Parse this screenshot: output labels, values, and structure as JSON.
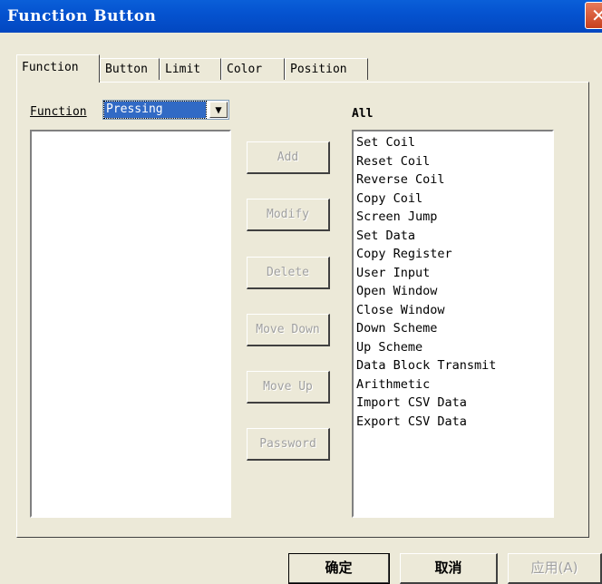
{
  "window": {
    "title": "Function Button",
    "close_glyph": "✕"
  },
  "tabs": [
    "Function",
    "Button",
    "Limit",
    "Color",
    "Position"
  ],
  "function_row": {
    "label": "Function",
    "combo_value": "Pressing"
  },
  "all_label": "All",
  "actions": {
    "add": "Add",
    "modify": "Modify",
    "delete": "Delete",
    "move_down": "Move Down",
    "move_up": "Move Up",
    "password": "Password"
  },
  "all_items": [
    "Set Coil",
    "Reset Coil",
    "Reverse Coil",
    "Copy Coil",
    "Screen Jump",
    "Set Data",
    "Copy Register",
    "User Input",
    "Open Window",
    "Close Window",
    "Down Scheme",
    "Up Scheme",
    "Data Block Transmit",
    "Arithmetic",
    "Import CSV Data",
    "Export CSV Data"
  ],
  "footer": {
    "ok": "确定",
    "cancel": "取消",
    "apply": "应用(A)"
  },
  "icons": {
    "dropdown": "chevron-down-icon",
    "close": "close-icon"
  }
}
